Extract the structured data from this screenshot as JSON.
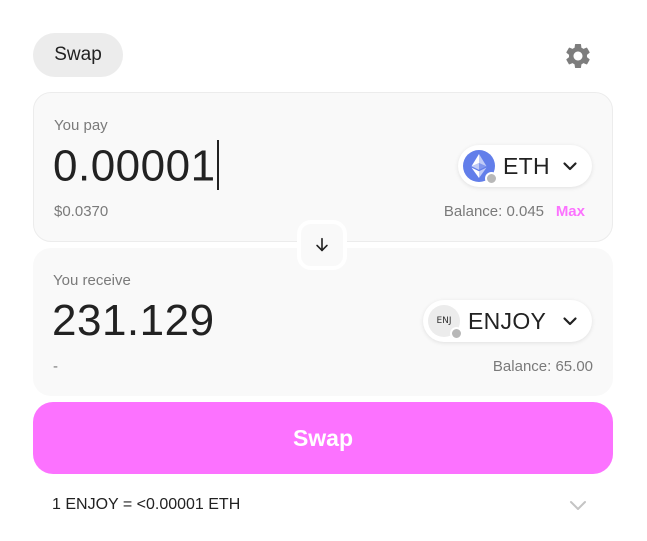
{
  "header": {
    "tab_label": "Swap",
    "settings_icon": "gear-icon"
  },
  "pay": {
    "label": "You pay",
    "amount": "0.00001",
    "token": {
      "symbol": "ETH",
      "icon": "ethereum-logo-icon"
    },
    "usd_value": "$0.0370",
    "balance": "Balance: 0.045",
    "max_label": "Max"
  },
  "flip": {
    "icon": "arrow-down-icon"
  },
  "receive": {
    "label": "You receive",
    "amount": "231.129",
    "token": {
      "symbol": "ENJOY",
      "logo_text": "ENJ",
      "icon": "enjoy-token-logo-icon"
    },
    "usd_value": "-",
    "balance": "Balance: 65.00"
  },
  "swap_button": {
    "label": "Swap"
  },
  "rate": {
    "text": "1 ENJOY = <0.00001 ETH",
    "icon": "chevron-down-icon"
  },
  "colors": {
    "accent": "#fc72ff",
    "panel_bg": "#f9f9f9",
    "muted_text": "#7a7a7a",
    "eth_blue": "#627eea"
  }
}
